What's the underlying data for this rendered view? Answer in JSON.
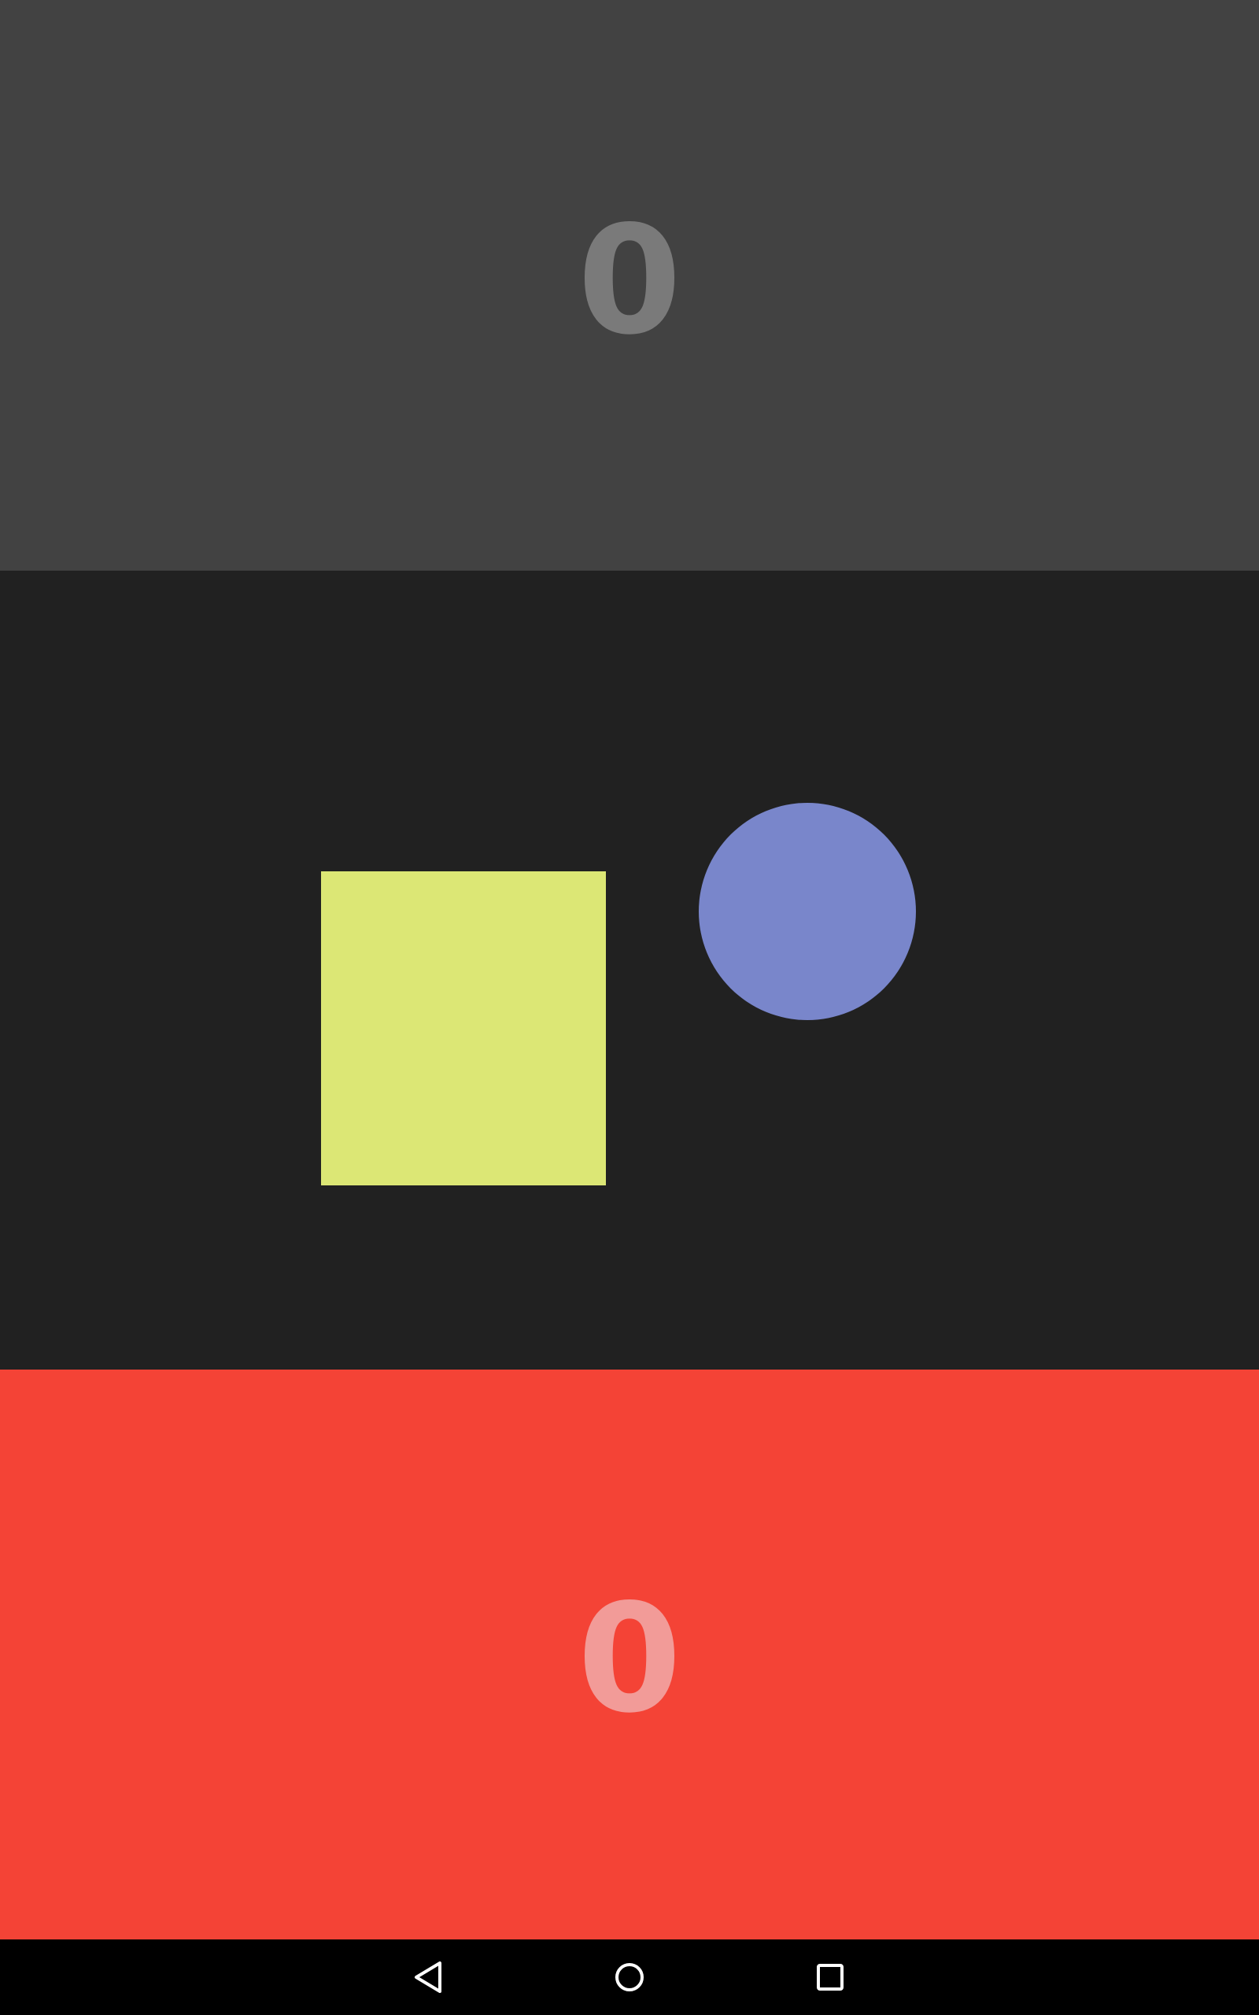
{
  "game": {
    "top_player": {
      "score": "0",
      "panel_color": "#424242",
      "score_color": "#7a7a7a"
    },
    "bottom_player": {
      "score": "0",
      "panel_color": "#f44336",
      "score_color": "#f29b98"
    },
    "board": {
      "background_color": "#212121",
      "pieces": [
        {
          "shape": "square",
          "color": "#dce775"
        },
        {
          "shape": "circle",
          "color": "#7986cb"
        }
      ]
    }
  },
  "navbar": {
    "buttons": [
      {
        "icon": "back-icon"
      },
      {
        "icon": "home-icon"
      },
      {
        "icon": "recents-icon"
      }
    ]
  }
}
